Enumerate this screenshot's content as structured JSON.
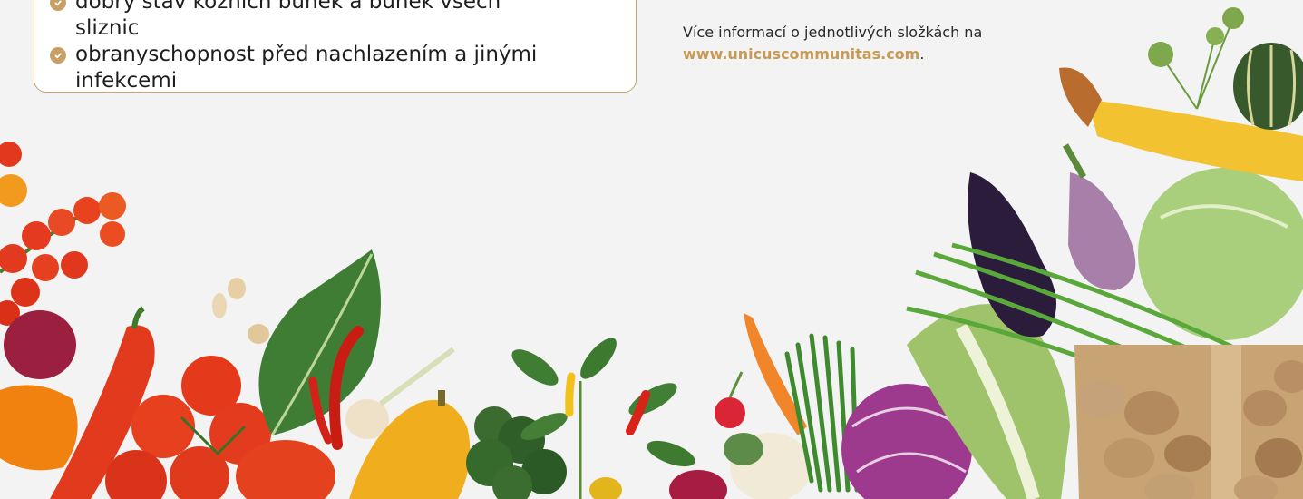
{
  "benefits": {
    "items": [
      "dobrý stav kožních buněk a buněk všech sliznic",
      "obranyschopnost před nachlazením a jinými infekcemi"
    ]
  },
  "info": {
    "text": "Více informací o jednotlivých složkách na",
    "link": "www.unicuscommunitas.com",
    "period": "."
  },
  "colors": {
    "accent": "#c79a55",
    "box_border": "#c9a46a"
  },
  "artwork": "vegetables-photo"
}
